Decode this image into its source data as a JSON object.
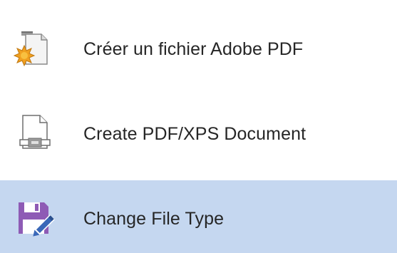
{
  "menu": {
    "items": [
      {
        "label": "Créer un fichier Adobe PDF",
        "icon": "adobe-pdf-create-icon"
      },
      {
        "label": "Create PDF/XPS Document",
        "icon": "pdf-xps-document-icon"
      },
      {
        "label": "Change File Type",
        "icon": "change-file-type-icon",
        "selected": true
      }
    ]
  },
  "colors": {
    "selected_background": "#c5d7f0",
    "text": "#262626",
    "save_icon_purple": "#8e5bb5",
    "star_orange": "#f0a020"
  }
}
